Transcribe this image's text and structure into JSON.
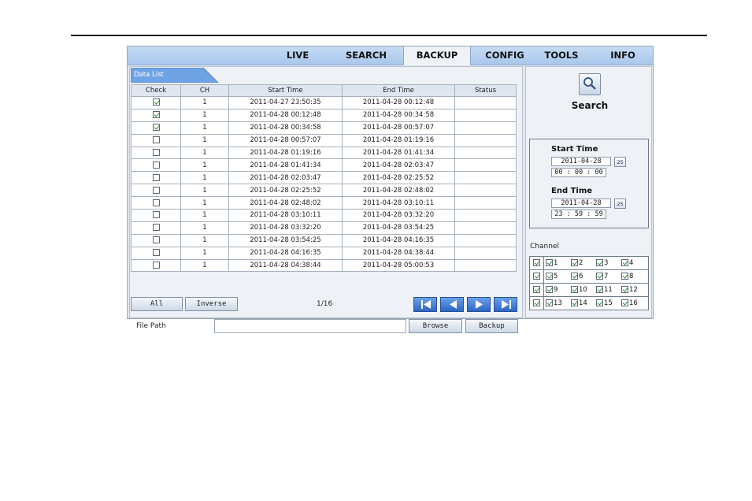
{
  "nav": {
    "tabs": [
      {
        "label": "LIVE"
      },
      {
        "label": "SEARCH"
      },
      {
        "label": "BACKUP"
      },
      {
        "label": "CONFIG"
      },
      {
        "label": "TOOLS"
      },
      {
        "label": "INFO"
      }
    ],
    "active": "BACKUP"
  },
  "data_list": {
    "tab_label": "Data List",
    "columns": [
      "Check",
      "CH",
      "Start Time",
      "End Time",
      "Status"
    ],
    "rows": [
      {
        "checked": true,
        "ch": "1",
        "start": "2011-04-27 23:50:35",
        "end": "2011-04-28 00:12:48",
        "status": ""
      },
      {
        "checked": true,
        "ch": "1",
        "start": "2011-04-28 00:12:48",
        "end": "2011-04-28 00:34:58",
        "status": ""
      },
      {
        "checked": true,
        "ch": "1",
        "start": "2011-04-28 00:34:58",
        "end": "2011-04-28 00:57:07",
        "status": ""
      },
      {
        "checked": false,
        "ch": "1",
        "start": "2011-04-28 00:57:07",
        "end": "2011-04-28 01:19:16",
        "status": ""
      },
      {
        "checked": false,
        "ch": "1",
        "start": "2011-04-28 01:19:16",
        "end": "2011-04-28 01:41:34",
        "status": ""
      },
      {
        "checked": false,
        "ch": "1",
        "start": "2011-04-28 01:41:34",
        "end": "2011-04-28 02:03:47",
        "status": ""
      },
      {
        "checked": false,
        "ch": "1",
        "start": "2011-04-28 02:03:47",
        "end": "2011-04-28 02:25:52",
        "status": ""
      },
      {
        "checked": false,
        "ch": "1",
        "start": "2011-04-28 02:25:52",
        "end": "2011-04-28 02:48:02",
        "status": ""
      },
      {
        "checked": false,
        "ch": "1",
        "start": "2011-04-28 02:48:02",
        "end": "2011-04-28 03:10:11",
        "status": ""
      },
      {
        "checked": false,
        "ch": "1",
        "start": "2011-04-28 03:10:11",
        "end": "2011-04-28 03:32:20",
        "status": ""
      },
      {
        "checked": false,
        "ch": "1",
        "start": "2011-04-28 03:32:20",
        "end": "2011-04-28 03:54:25",
        "status": ""
      },
      {
        "checked": false,
        "ch": "1",
        "start": "2011-04-28 03:54:25",
        "end": "2011-04-28 04:16:35",
        "status": ""
      },
      {
        "checked": false,
        "ch": "1",
        "start": "2011-04-28 04:16:35",
        "end": "2011-04-28 04:38:44",
        "status": ""
      },
      {
        "checked": false,
        "ch": "1",
        "start": "2011-04-28 04:38:44",
        "end": "2011-04-28 05:00:53",
        "status": ""
      }
    ]
  },
  "controls": {
    "all_label": "All",
    "inverse_label": "Inverse",
    "page": "1/16",
    "file_path_label": "File Path",
    "file_path_value": "",
    "browse_label": "Browse",
    "backup_label": "Backup"
  },
  "search": {
    "label": "Search",
    "start_time_label": "Start Time",
    "start_date": "2011-04-28",
    "start_time": "00 : 00 : 00",
    "end_time_label": "End Time",
    "end_date": "2011-04-28",
    "end_time": "23 : 59 : 59",
    "calendar_label": "25"
  },
  "channel": {
    "label": "Channel",
    "rows": [
      {
        "all": true,
        "channels": [
          {
            "n": "1",
            "checked": true
          },
          {
            "n": "2",
            "checked": true
          },
          {
            "n": "3",
            "checked": true
          },
          {
            "n": "4",
            "checked": true
          }
        ]
      },
      {
        "all": true,
        "channels": [
          {
            "n": "5",
            "checked": true
          },
          {
            "n": "6",
            "checked": true
          },
          {
            "n": "7",
            "checked": true
          },
          {
            "n": "8",
            "checked": true
          }
        ]
      },
      {
        "all": true,
        "channels": [
          {
            "n": "9",
            "checked": true
          },
          {
            "n": "10",
            "checked": true
          },
          {
            "n": "11",
            "checked": true
          },
          {
            "n": "12",
            "checked": true
          }
        ]
      },
      {
        "all": true,
        "channels": [
          {
            "n": "13",
            "checked": true
          },
          {
            "n": "14",
            "checked": true
          },
          {
            "n": "15",
            "checked": true
          },
          {
            "n": "16",
            "checked": true
          }
        ]
      }
    ]
  },
  "colors": {
    "accent": "#6ea3e6",
    "nav_bg": "#b6d0f0"
  }
}
